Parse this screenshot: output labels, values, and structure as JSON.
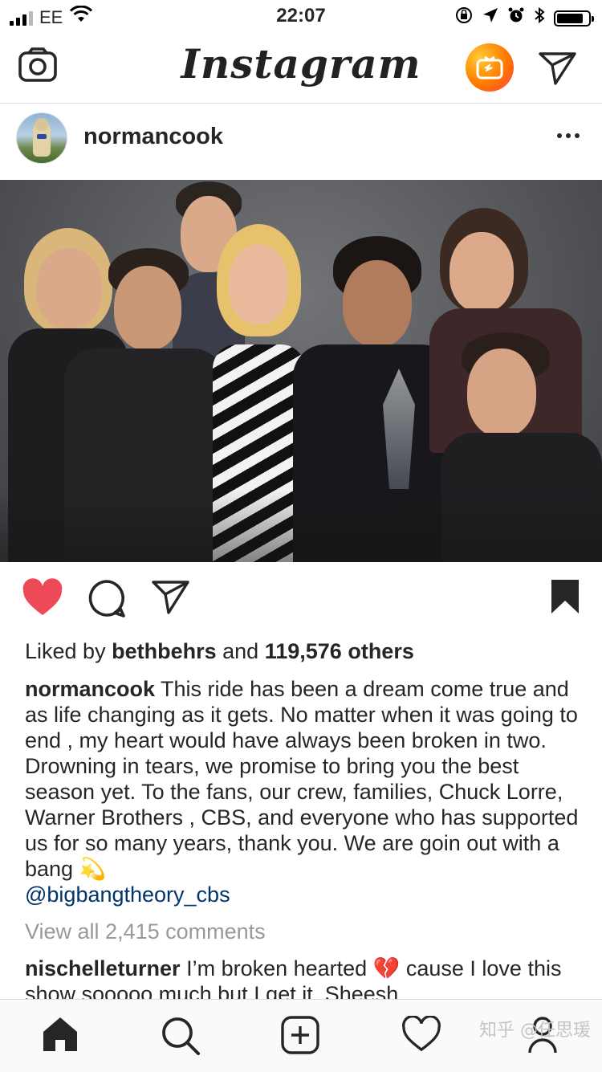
{
  "status_bar": {
    "carrier": "EE",
    "time": "22:07",
    "battery_level": 0.85
  },
  "nav": {
    "logo": "Instagram",
    "icons": [
      "camera-icon",
      "igtv-icon",
      "direct-message-icon"
    ]
  },
  "post": {
    "username": "normancook",
    "actions": [
      "like-icon",
      "comment-icon",
      "share-icon",
      "save-icon"
    ],
    "likes": {
      "prefix": "Liked by",
      "user": "bethbehrs",
      "middle": "and",
      "others": "119,576 others"
    },
    "caption": {
      "username": "normancook",
      "text": "This ride has been a dream come true and as life changing as it gets. No matter when it was going to end , my heart would have always been broken in two. Drowning in tears, we promise to bring you the best season yet. To the fans, our crew, families, Chuck Lorre, Warner Brothers , CBS, and everyone who has supported us for so many years, thank you. We are goin out with a bang",
      "emoji": "💫",
      "mention": "@bigbangtheory_cbs"
    },
    "view_all_comments": "View all 2,415 comments",
    "comment": {
      "username": "nischelleturner",
      "text": "I’m broken hearted",
      "emoji": "💔",
      "text_after": "cause I love this show sooooo much but I get it. Sheesh"
    }
  },
  "tab_bar": {
    "items": [
      "home-icon",
      "search-icon",
      "new-post-icon",
      "activity-icon",
      "profile-icon"
    ],
    "watermark": "知乎 @任思瑗"
  },
  "colors": {
    "like_red": "#ed4956",
    "link_blue": "#003569",
    "muted_gray": "#999999",
    "igtv_orange": "#ff7a00"
  }
}
